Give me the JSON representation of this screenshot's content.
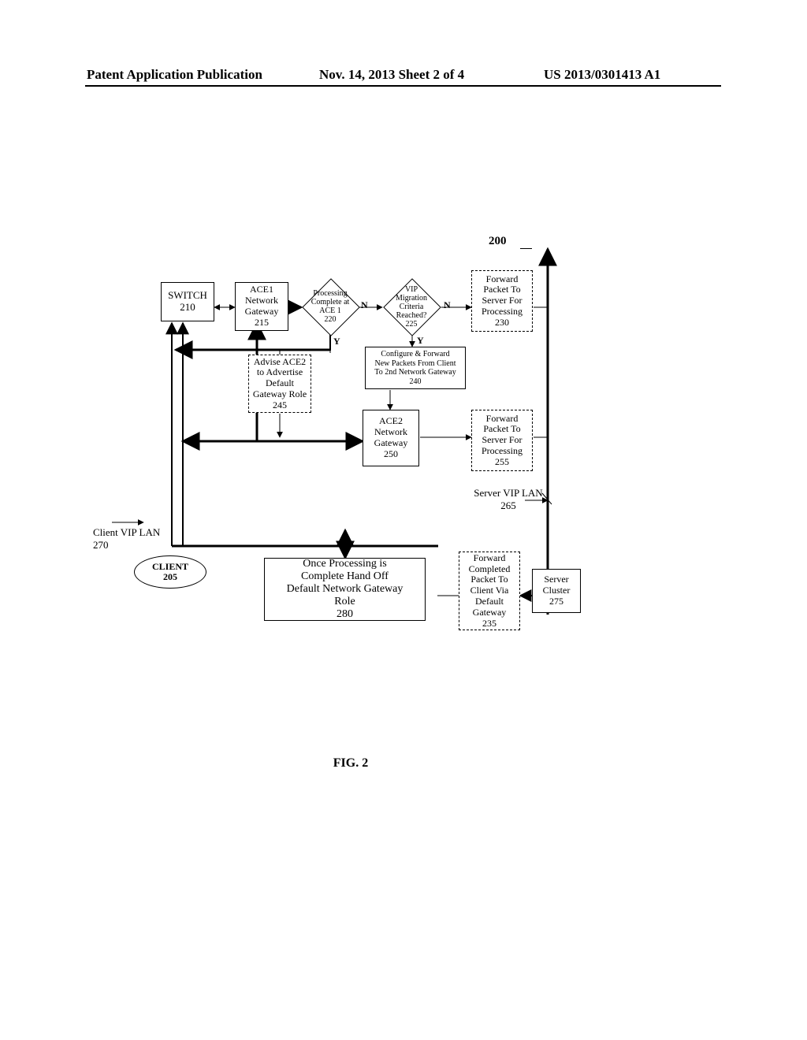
{
  "header": {
    "left": "Patent Application Publication",
    "center": "Nov. 14, 2013  Sheet 2 of 4",
    "right": "US 2013/0301413 A1"
  },
  "ref200": "200",
  "fig_label": "FIG. 2",
  "nodes": {
    "switch": "SWITCH\n210",
    "ace1_gw": "ACE1\nNetwork\nGateway\n215",
    "proc_complete": "Processing\nComplete at\nACE 1\n220",
    "vip_crit": "VIP\nMigration\nCriteria\nReached?\n225",
    "fwd_server_230": "Forward\nPacket To\nServer For\nProcessing\n230",
    "cfg_fwd_240": "Configure & Forward\nNew Packets From Client\nTo 2nd Network Gateway\n240",
    "advise_245": "Advise ACE2\nto Advertise\nDefault\nGateway Role\n245",
    "ace2_gw": "ACE2\nNetwork\nGateway\n250",
    "fwd_server_255": "Forward\nPacket To\nServer For\nProcessing\n255",
    "server_lan_265": "Server VIP LAN\n265",
    "client_lan_270": "Client VIP LAN\n270",
    "client_205": "CLIENT\n205",
    "handoff_280": "Once Processing is\nComplete Hand Off\nDefault Network Gateway\nRole\n280",
    "fwd_client_235": "Forward\nCompleted\nPacket To\nClient Via\nDefault\nGateway\n235",
    "server_cluster_275": "Server\nCluster\n275"
  },
  "yn": {
    "y": "Y",
    "n": "N"
  }
}
